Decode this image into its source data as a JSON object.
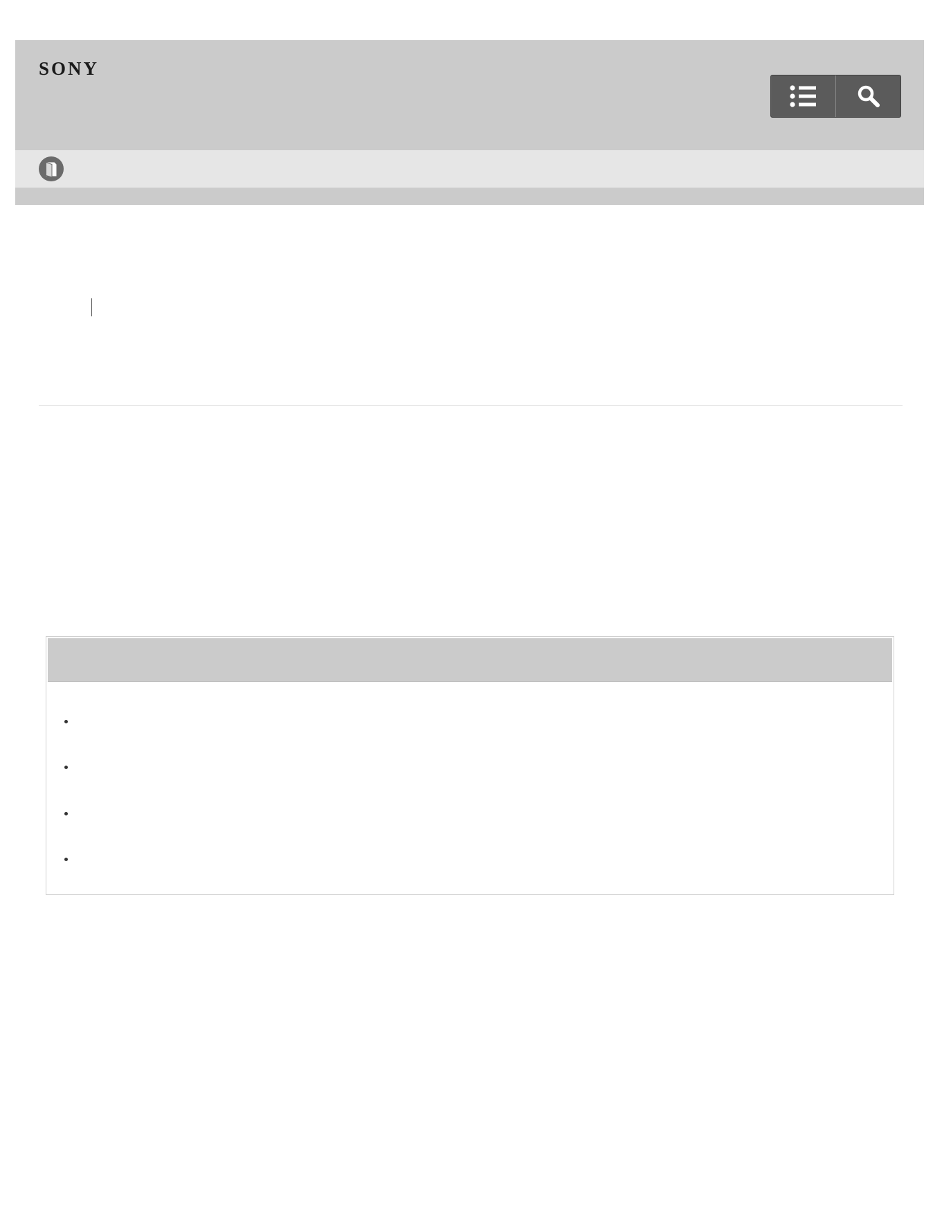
{
  "header": {
    "logo_text": "SONY",
    "menu_button": {
      "icon": "list-icon"
    },
    "search_button": {
      "icon": "search-icon"
    }
  },
  "subbar": {
    "icon": "manual-icon"
  },
  "colors": {
    "header_bg": "#cbcbcb",
    "subbar_bg": "#e6e6e6",
    "button_bg": "#5b5b5b",
    "icon_fg": "#ffffff"
  },
  "note": {
    "heading": "",
    "items": [
      "",
      "",
      "",
      ""
    ]
  }
}
